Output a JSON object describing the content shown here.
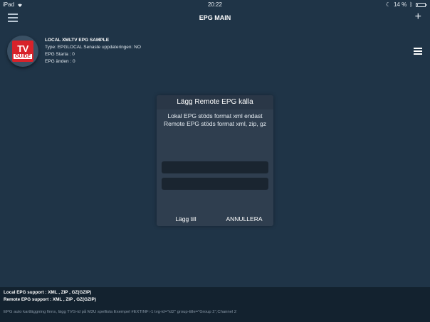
{
  "statusbar": {
    "device": "iPad",
    "time": "20:22",
    "battery_text": "14 %",
    "battery_level": 0.14,
    "icons": [
      "wifi-icon",
      "moon-icon",
      "bluetooth-icon",
      "battery-icon"
    ]
  },
  "navbar": {
    "title": "EPG MAIN",
    "menu_icon": "hamburger-icon",
    "add_icon": "plus-icon",
    "add_glyph": "+"
  },
  "epg_source": {
    "logo_line1": "TV",
    "logo_line2": "GUIDE",
    "name": "LOCAL XMLTV EPG SAMPLE",
    "type_line": "Type: EPGLOCAL Senaste uppdateringen: NO",
    "start_line": "EPG Starta : 0",
    "end_line": "EPG änden : 0",
    "menu_icon": "hamburger-icon"
  },
  "dialog": {
    "title": "Lägg Remote EPG källa",
    "message_line1": "Lokal EPG stöds format xml endast",
    "message_line2": "Remote EPG stöds format xml, zip, gz",
    "field1_value": "",
    "field2_value": "",
    "add_label": "Lägg till",
    "cancel_label": "ANNULLERA"
  },
  "footer": {
    "local_support": "Local EPG support : XML , ZIP , GZ(GZIP)",
    "remote_support": "Remote EPG support : XML , ZIP , GZ(GZIP)",
    "note": "EPG auto kartläggning finns, lägg TVG-id på M3U spellista Exempel #EXTINF:-1 tvg-id=\"id2\" group-title=\"Group 2\",Channel 2"
  }
}
